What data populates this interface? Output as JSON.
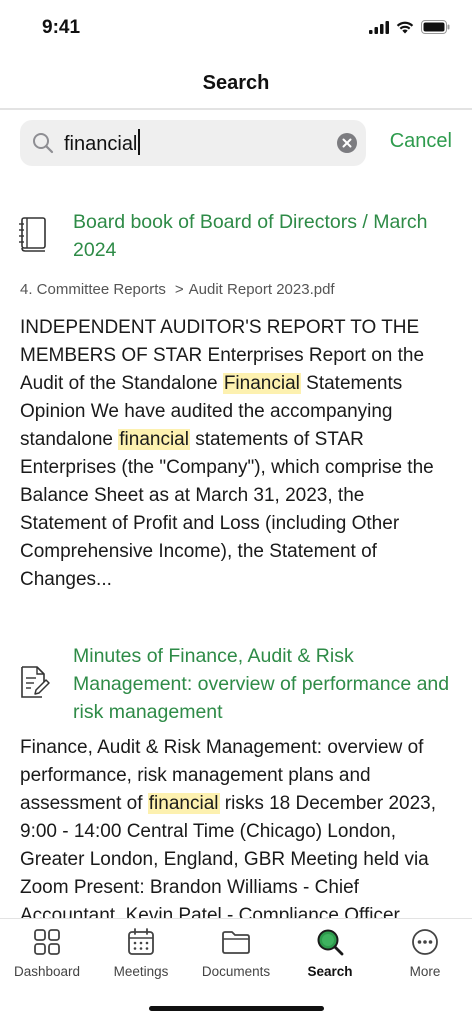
{
  "status_bar": {
    "time": "9:41"
  },
  "nav": {
    "title": "Search"
  },
  "search": {
    "query": "financial",
    "cancel_label": "Cancel"
  },
  "results": [
    {
      "icon": "book-icon",
      "title": "Board book of Board of Directors / March 2024",
      "breadcrumb": [
        "4. Committee Reports",
        "Audit Report 2023.pdf"
      ],
      "snippet": [
        {
          "text": "INDEPENDENT AUDITOR'S REPORT TO THE MEMBERS OF STAR Enterprises Report on the Audit of the Standalone ",
          "hl": false
        },
        {
          "text": "Financial",
          "hl": true
        },
        {
          "text": " Statements Opinion We have audited the accompanying standalone ",
          "hl": false
        },
        {
          "text": "financial",
          "hl": true
        },
        {
          "text": " statements of STAR Enterprises (the \"Company\"), which comprise the Balance Sheet as at March 31, 2023, the Statement of Profit and Loss (including Other Comprehensive Income), the Statement of Changes...",
          "hl": false
        }
      ]
    },
    {
      "icon": "document-edit-icon",
      "title": "Minutes of Finance, Audit & Risk Management: overview of performance and risk management",
      "snippet": [
        {
          "text": "Finance, Audit & Risk Management: overview of performance, risk management plans and assessment of ",
          "hl": false
        },
        {
          "text": "financial",
          "hl": true
        },
        {
          "text": " risks 18 December 2023, 9:00 - 14:00 Central Time (Chicago) London, Greater London, England, GBR Meeting held via Zoom Present: Brandon Williams - Chief Accountant, Kevin Patel - Compliance Officer",
          "hl": false
        }
      ]
    }
  ],
  "tabs": [
    {
      "label": "Dashboard",
      "icon": "dashboard-grid-icon",
      "active": false
    },
    {
      "label": "Meetings",
      "icon": "calendar-icon",
      "active": false
    },
    {
      "label": "Documents",
      "icon": "folder-icon",
      "active": false
    },
    {
      "label": "Search",
      "icon": "search-icon",
      "active": true
    },
    {
      "label": "More",
      "icon": "more-dots-icon",
      "active": false
    }
  ],
  "colors": {
    "accent": "#2e9b4d",
    "title_green": "#2e8b47",
    "highlight": "#fdf1b0"
  }
}
